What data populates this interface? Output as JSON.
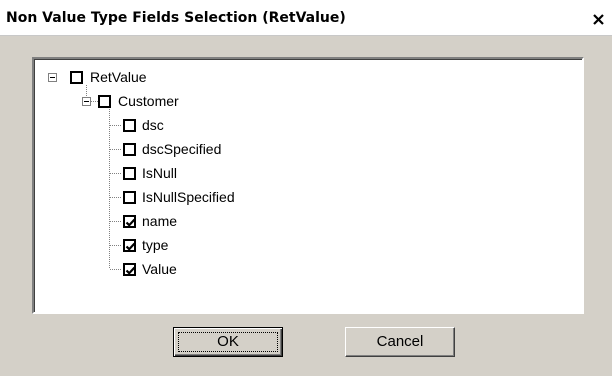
{
  "window": {
    "title": "Non Value Type Fields Selection (RetValue)",
    "close_glyph": "×"
  },
  "tree": {
    "root": {
      "label": "RetValue",
      "checked": false,
      "expanded": true
    },
    "child": {
      "label": "Customer",
      "checked": false,
      "expanded": true
    },
    "leaves": [
      {
        "label": "dsc",
        "checked": false
      },
      {
        "label": "dscSpecified",
        "checked": false
      },
      {
        "label": "IsNull",
        "checked": false
      },
      {
        "label": "IsNullSpecified",
        "checked": false
      },
      {
        "label": "name",
        "checked": true
      },
      {
        "label": "type",
        "checked": true
      },
      {
        "label": "Value",
        "checked": true
      }
    ]
  },
  "buttons": {
    "ok_label": "OK",
    "cancel_label": "Cancel"
  }
}
